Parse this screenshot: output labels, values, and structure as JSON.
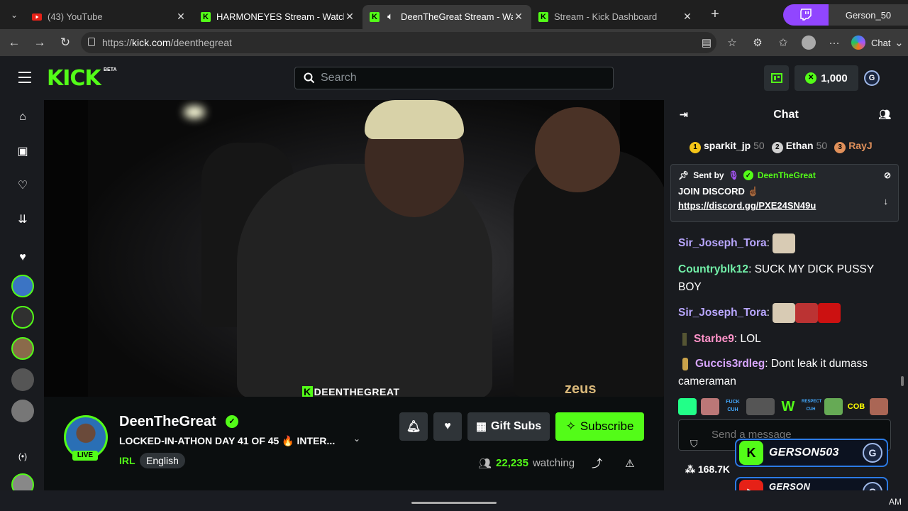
{
  "browser": {
    "tabs": [
      {
        "title": "(43) YouTube",
        "icon": "youtube-icon",
        "active": false
      },
      {
        "title": "HARMONEYES Stream - Watch Live",
        "icon": "kick-icon",
        "active": false
      },
      {
        "title": "DeenTheGreat Stream - Watch",
        "icon": "kick-icon",
        "active": true
      },
      {
        "title": "Stream - Kick Dashboard",
        "icon": "kick-icon",
        "active": false
      }
    ],
    "profile_name": "Gerson_50",
    "url_prefix": "https://",
    "url_domain": "kick.com",
    "url_path": "/deenthegreat",
    "chat_label": "Chat"
  },
  "kick": {
    "logo": "KICK",
    "beta": "BETA",
    "search_placeholder": "Search",
    "points": "1,000"
  },
  "stream": {
    "watermark_k": "K",
    "watermark": "DEENTHEGREAT",
    "sponsor": "zeus",
    "streamer": "DeenTheGreat",
    "live": "LIVE",
    "title": "LOCKED-IN-ATHON DAY 41 OF 45 🔥 INTER...",
    "category": "IRL",
    "language": "English",
    "gift_subs": "Gift Subs",
    "subscribe": "Subscribe",
    "viewers": "22,235",
    "watching": "watching"
  },
  "chat": {
    "header": "Chat",
    "leaderboard": [
      {
        "rank": "1",
        "name": "sparkit_jp",
        "points": "50",
        "color": "#f5c518"
      },
      {
        "rank": "2",
        "name": "Ethan",
        "points": "50",
        "color": "#d0d0d0"
      },
      {
        "rank": "3",
        "name": "RayJ",
        "points": "",
        "color": "#e0905a"
      }
    ],
    "pinned": {
      "sent_by": "Sent by",
      "author": "DeenTheGreat",
      "message": "JOIN DISCORD ☝🏾",
      "link": "https://discord.gg/PXE24SN49u"
    },
    "messages": [
      {
        "user": "Sir_Joseph_Tora",
        "color": "#b9a7ff",
        "text": ""
      },
      {
        "user": "Countryblk12",
        "color": "#72f0a8",
        "text": "SUCK MY DICK PUSSY BOY"
      },
      {
        "user": "Sir_Joseph_Tora",
        "color": "#b9a7ff",
        "text": ""
      },
      {
        "user": "Starbe9",
        "color": "#ff93c9",
        "text": "LOL"
      },
      {
        "user": "Guccis3rdleg",
        "color": "#d8a5ff",
        "text": "Dont leak it dumass cameraman"
      }
    ],
    "emote_labels": [
      "FUCK CUH",
      "W",
      "RESPECT CUH",
      "COB"
    ],
    "input_placeholder": "Send a message",
    "followers": "168.7K"
  },
  "overlays": [
    {
      "name": "GERSON503",
      "badge": "K",
      "badge_color": "#53fc18",
      "glyph": "G"
    },
    {
      "name": "GERSON QUINTANILLA",
      "badge": "▶",
      "badge_color": "#e62117",
      "glyph": "G"
    }
  ],
  "taskbar": {
    "clock": "AM"
  }
}
